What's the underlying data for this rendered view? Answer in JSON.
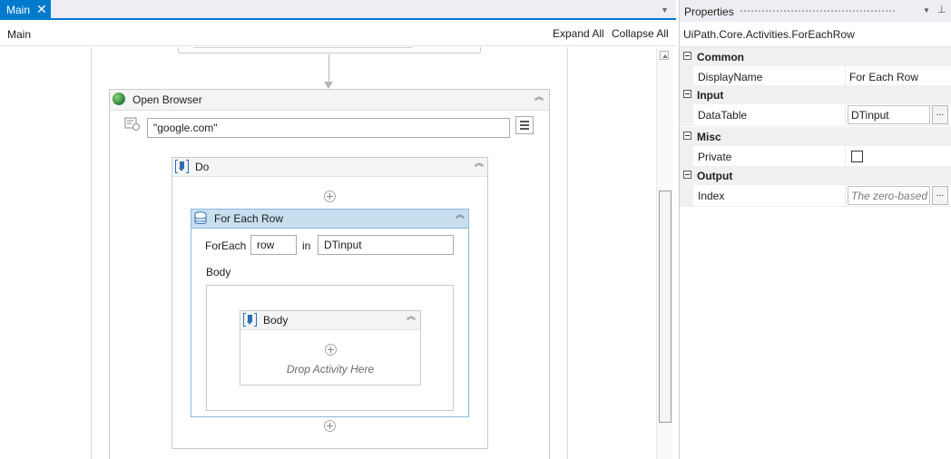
{
  "designer": {
    "tab": {
      "label": "Main",
      "close": "✕"
    },
    "breadcrumb": "Main",
    "expand_all": "Expand All",
    "collapse_all": "Collapse All"
  },
  "workflow": {
    "open_browser": {
      "title": "Open Browser",
      "url": "\"google.com\""
    },
    "do_sequence": {
      "title": "Do"
    },
    "for_each_row": {
      "title": "For Each Row",
      "foreach_label": "ForEach",
      "item_var": "row",
      "in_label": "in",
      "collection": "DTinput",
      "body_label": "Body"
    },
    "body_sequence": {
      "title": "Body",
      "drop_hint": "Drop Activity Here"
    }
  },
  "properties": {
    "panel_title": "Properties",
    "activity_type": "UiPath.Core.Activities.ForEachRow",
    "categories": [
      {
        "name": "Common",
        "rows": [
          {
            "name": "DisplayName",
            "value": "For Each Row"
          }
        ]
      },
      {
        "name": "Input",
        "rows": [
          {
            "name": "DataTable",
            "value": "DTinput",
            "button": "..."
          }
        ]
      },
      {
        "name": "Misc",
        "rows": [
          {
            "name": "Private",
            "checked": false
          }
        ]
      },
      {
        "name": "Output",
        "rows": [
          {
            "name": "Index",
            "placeholder": "The zero-based",
            "button": "..."
          }
        ]
      }
    ]
  },
  "colors": {
    "accent": "#007acc",
    "selected_header": "#c8dff0",
    "selected_border": "#8eb9db"
  }
}
